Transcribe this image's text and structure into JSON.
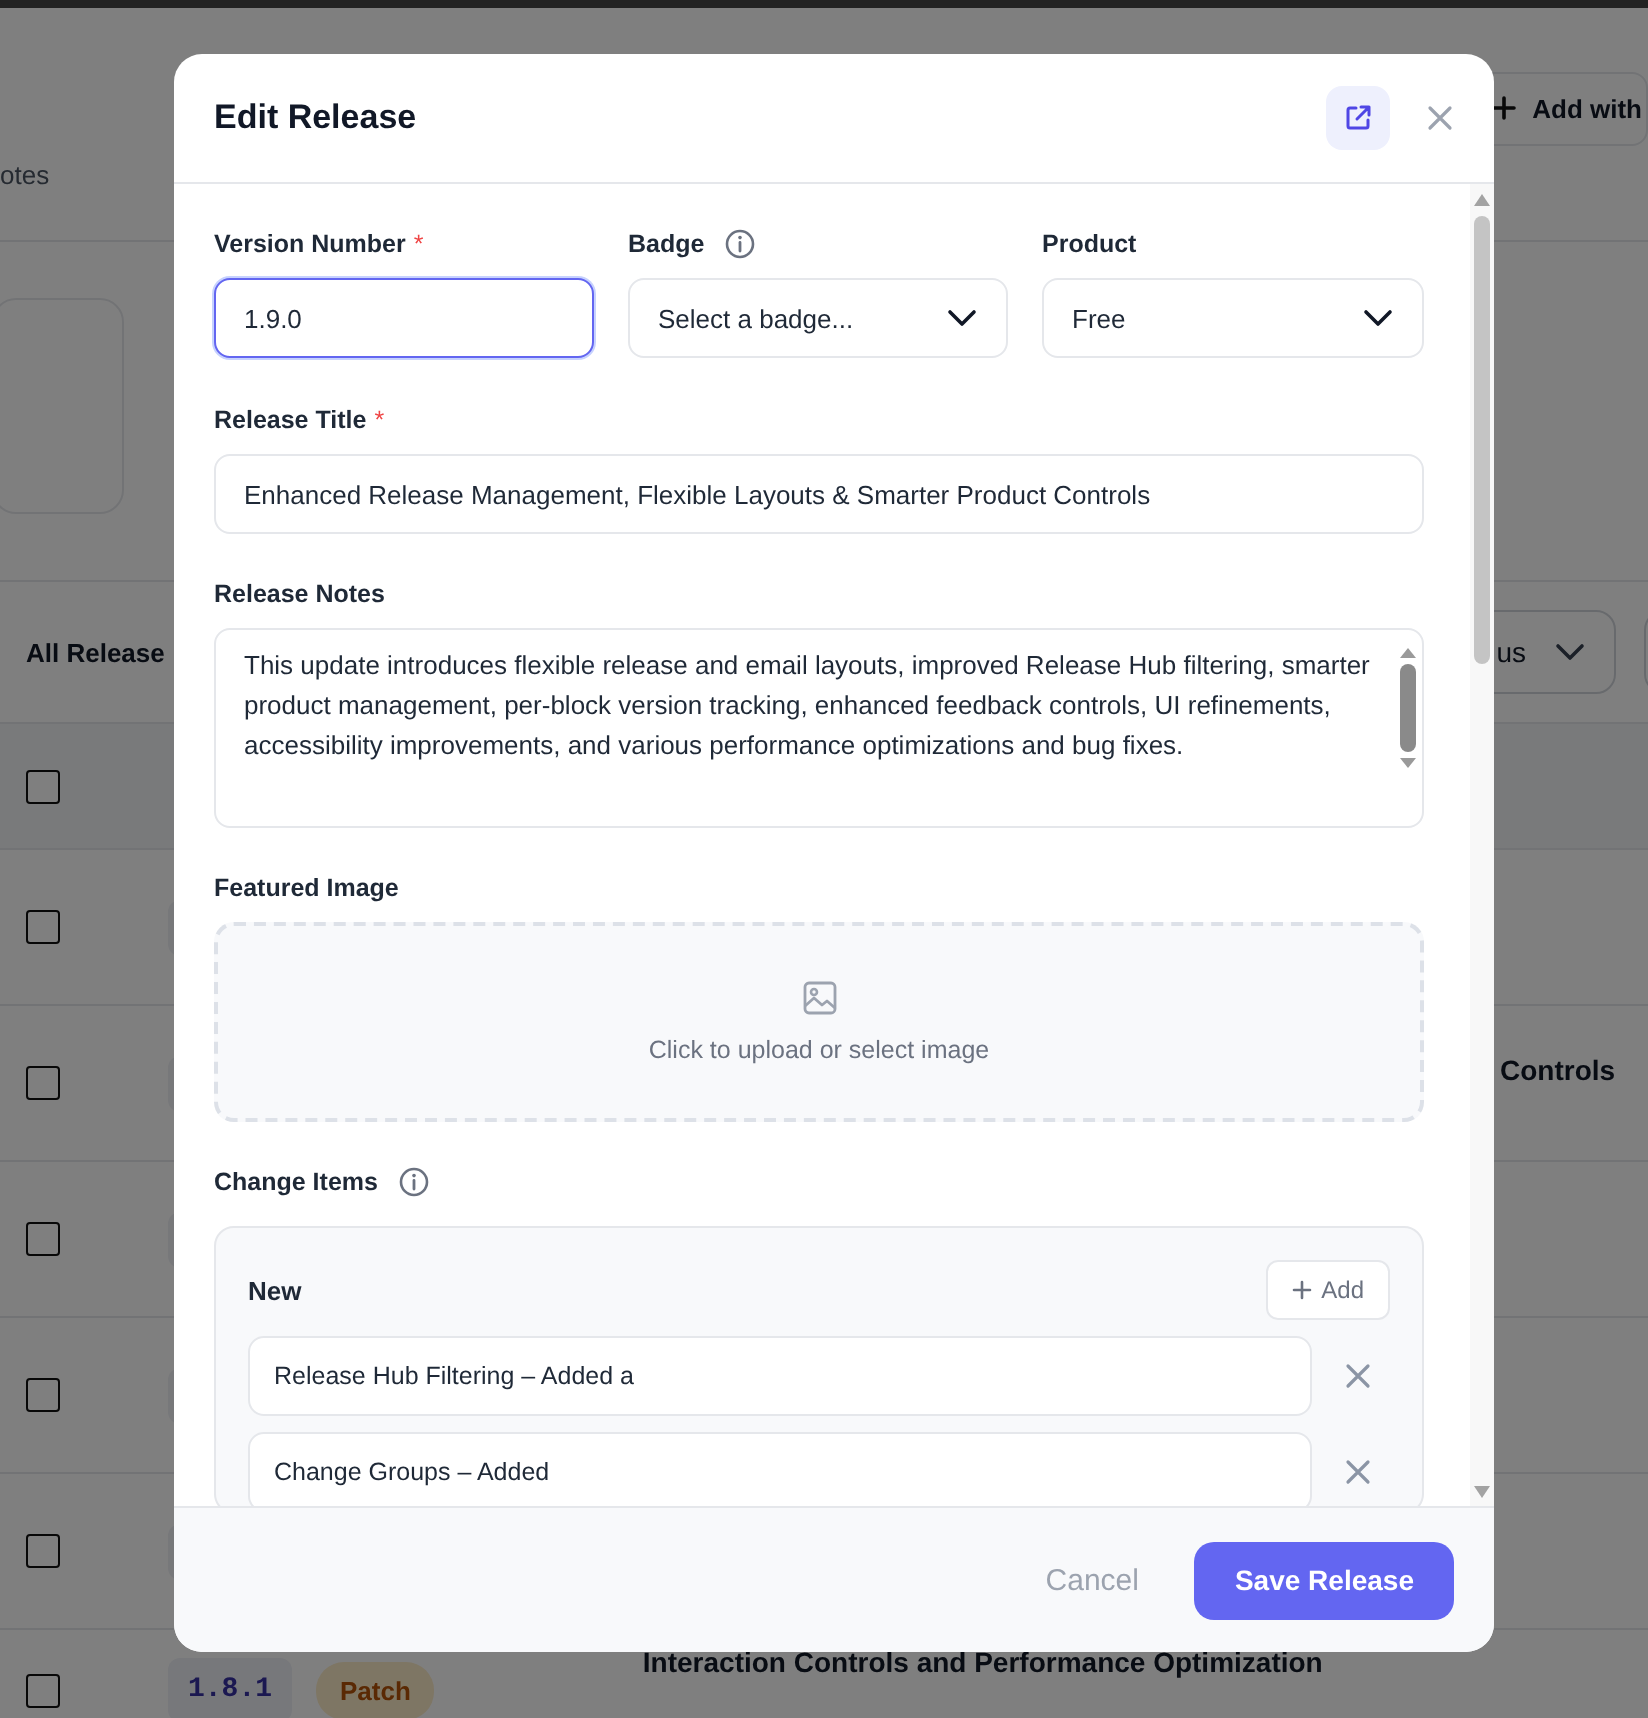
{
  "background": {
    "tab_fragment": "otes",
    "add_button": "Add with",
    "section_title": "All Release",
    "status_filter": "us",
    "rows": [
      {
        "checked": false,
        "title": ""
      },
      {
        "checked": false,
        "title": "Controls"
      },
      {
        "checked": false,
        "title": ""
      },
      {
        "checked": false,
        "title": ""
      },
      {
        "checked": false,
        "title": ""
      }
    ],
    "last_row": {
      "checked": false,
      "version": "1.8.1",
      "badge": "Patch",
      "title": "Interaction Controls and Performance Optimization"
    },
    "header_checked": false
  },
  "dialog": {
    "title": "Edit Release",
    "version": {
      "label": "Version Number",
      "marker": "*",
      "value": "1.9.0",
      "focused": true
    },
    "badge": {
      "label": "Badge",
      "placeholder": "Select a badge..."
    },
    "product": {
      "label": "Product",
      "value": "Free"
    },
    "release_title": {
      "label": "Release Title",
      "marker": "*",
      "value": "Enhanced Release Management, Flexible Layouts & Smarter Product Controls"
    },
    "release_notes": {
      "label": "Release Notes",
      "value": "This update introduces flexible release and email layouts, improved Release Hub filtering, smarter product management, per-block version tracking, enhanced feedback controls, UI refinements, accessibility improvements, and various performance optimizations and bug fixes."
    },
    "featured_image": {
      "label": "Featured Image",
      "prompt": "Click to upload or select image"
    },
    "change_items": {
      "label": "Change Items",
      "groups": [
        {
          "name": "New",
          "add": "Add",
          "items": [
            "Release Hub Filtering – Added a",
            "Change Groups – Added"
          ]
        }
      ]
    },
    "buttons": {
      "cancel": "Cancel",
      "save": "Save Release"
    }
  }
}
